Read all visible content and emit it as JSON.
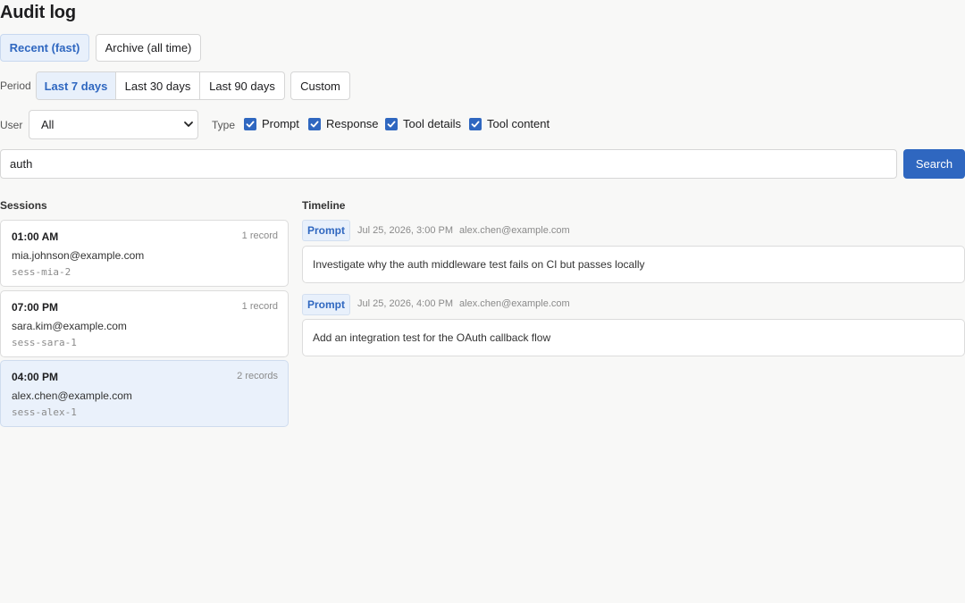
{
  "page": {
    "title": "Audit log"
  },
  "source_tabs": [
    {
      "label": "Recent (fast)",
      "active": true
    },
    {
      "label": "Archive (all time)",
      "active": false
    }
  ],
  "period": {
    "label": "Period",
    "options": [
      {
        "label": "Last 7 days",
        "active": true
      },
      {
        "label": "Last 30 days",
        "active": false
      },
      {
        "label": "Last 90 days",
        "active": false
      }
    ],
    "custom_label": "Custom"
  },
  "filters": {
    "user_label": "User",
    "user_value": "All",
    "type_label": "Type",
    "types": [
      {
        "label": "Prompt",
        "checked": true
      },
      {
        "label": "Response",
        "checked": true
      },
      {
        "label": "Tool details",
        "checked": true
      },
      {
        "label": "Tool content",
        "checked": true
      }
    ]
  },
  "search": {
    "value": "auth",
    "button_label": "Search"
  },
  "sessions": {
    "title": "Sessions",
    "items": [
      {
        "time": "01:00 AM",
        "count": "1 record",
        "user": "mia.johnson@example.com",
        "id": "sess-mia-2",
        "selected": false
      },
      {
        "time": "07:00 PM",
        "count": "1 record",
        "user": "sara.kim@example.com",
        "id": "sess-sara-1",
        "selected": false
      },
      {
        "time": "04:00 PM",
        "count": "2 records",
        "user": "alex.chen@example.com",
        "id": "sess-alex-1",
        "selected": true
      }
    ]
  },
  "timeline": {
    "title": "Timeline",
    "events": [
      {
        "type": "Prompt",
        "timestamp": "Jul 25, 2026, 3:00 PM",
        "user": "alex.chen@example.com",
        "text": "Investigate why the auth middleware test fails on CI but passes locally"
      },
      {
        "type": "Prompt",
        "timestamp": "Jul 25, 2026, 4:00 PM",
        "user": "alex.chen@example.com",
        "text": "Add an integration test for the OAuth callback flow"
      }
    ]
  },
  "colors": {
    "accent": "#2f67c0",
    "accent_bg": "#e8f0fb",
    "page_bg": "#f8f8f7"
  }
}
